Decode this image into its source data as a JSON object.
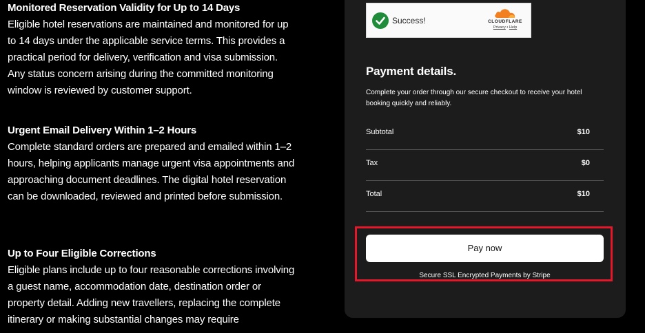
{
  "features": [
    {
      "title": "Monitored Reservation Validity for Up to 14 Days",
      "body": "Eligible hotel reservations are maintained and monitored for up to 14 days under the applicable service terms. This provides a practical period for delivery, verification and visa submission. Any status concern arising during the committed monitoring window is reviewed by customer support."
    },
    {
      "title": "Urgent Email Delivery Within 1–2 Hours",
      "body": "Complete standard orders are prepared and emailed within 1–2 hours, helping applicants manage urgent visa appointments and approaching document deadlines. The digital hotel reservation can be downloaded, reviewed and printed before submission."
    },
    {
      "title": "Up to Four Eligible Corrections",
      "body": "Eligible plans include up to four reasonable corrections involving a guest name, accommodation date, destination order or property detail. Adding new travellers, replacing the complete itinerary or making substantial changes may require"
    }
  ],
  "captcha": {
    "status_text": "Success!",
    "brand": "CLOUDFLARE",
    "privacy_link": "Privacy",
    "separator": "•",
    "help_link": "Help"
  },
  "payment": {
    "title": "Payment details.",
    "description": "Complete your order through our secure checkout to receive your hotel booking quickly and reliably.",
    "rows": [
      {
        "label": "Subtotal",
        "value": "$10"
      },
      {
        "label": "Tax",
        "value": "$0"
      },
      {
        "label": "Total",
        "value": "$10"
      }
    ],
    "pay_button_label": "Pay now",
    "secure_note": "Secure SSL Encrypted Payments by Stripe"
  },
  "colors": {
    "background": "#000000",
    "card": "#1c1c1c",
    "highlight": "#e3182a",
    "success_green": "#1e8c3a",
    "cloudflare_orange": "#f38020"
  }
}
